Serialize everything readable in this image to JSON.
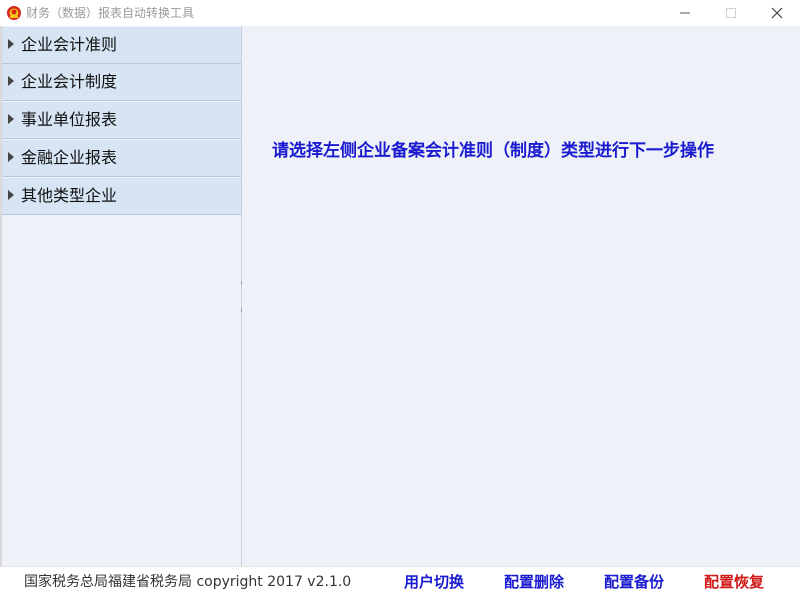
{
  "window": {
    "title": "财务（数据）报表自动转换工具",
    "app_icon": "national-emblem-icon",
    "controls": [
      "minimize-icon",
      "maximize-icon",
      "close-icon"
    ]
  },
  "sidebar": {
    "items": [
      {
        "label": "企业会计准则",
        "icon": "triangle-right-icon"
      },
      {
        "label": "企业会计制度",
        "icon": "triangle-right-icon"
      },
      {
        "label": "事业单位报表",
        "icon": "triangle-right-icon"
      },
      {
        "label": "金融企业报表",
        "icon": "triangle-right-icon"
      },
      {
        "label": "其他类型企业",
        "icon": "triangle-right-icon"
      }
    ]
  },
  "main": {
    "instruction": "请选择左侧企业备案会计准则（制度）类型进行下一步操作"
  },
  "footer": {
    "copyright": "国家税务总局福建省税务局  copyright 2017  v2.1.0",
    "user_switch": "用户切换",
    "config_delete": "配置删除",
    "config_backup": "配置备份",
    "config_restore": "配置恢复"
  },
  "colors": {
    "accent_blue": "#1a1ad0",
    "restore_red": "#d01a1a",
    "panel_bg": "#eef2f8",
    "nav_item_bg": "#d6e4f3"
  }
}
